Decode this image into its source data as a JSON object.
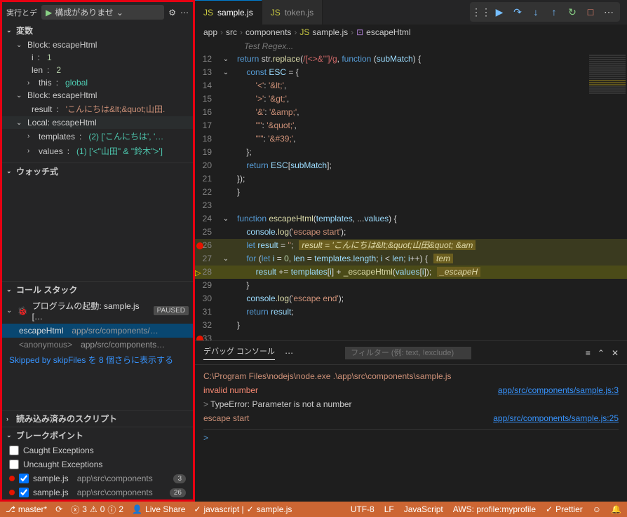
{
  "sidebar": {
    "top_label": "実行とデ",
    "config_label": "構成がありませ",
    "sections": {
      "variables": "変数",
      "watch": "ウォッチ式",
      "callstack": "コール スタック",
      "loaded": "読み込み済みのスクリプト",
      "breakpoints": "ブレークポイント"
    },
    "vars": {
      "block1": "Block: escapeHtml",
      "i_key": "i",
      "i_val": "1",
      "len_key": "len",
      "len_val": "2",
      "this_key": "this",
      "this_val": "global",
      "block2": "Block: escapeHtml",
      "result_key": "result",
      "result_val": "'こんにちは&lt;&quot;山田.",
      "local": "Local: escapeHtml",
      "templates_key": "templates",
      "templates_val": "(2) ['こんにちは', '…",
      "values_key": "values",
      "values_val": "(1) ['<\"山田\" & \"鈴木\">']"
    },
    "callstack": {
      "launch": "プログラムの起動: sample.js […",
      "paused": "PAUSED",
      "row1_fn": "escapeHtml",
      "row1_path": "app/src/components/…",
      "row2_fn": "<anonymous>",
      "row2_path": "app/src/components…",
      "skipped": "Skipped by skipFiles を 8 個さらに表示する"
    },
    "breakpoints": {
      "caught": "Caught Exceptions",
      "uncaught": "Uncaught Exceptions",
      "bp1_file": "sample.js",
      "bp1_path": "app\\src\\components",
      "bp1_count": "3",
      "bp2_file": "sample.js",
      "bp2_path": "app\\src\\components",
      "bp2_count": "26"
    }
  },
  "tabs": {
    "t1": "sample.js",
    "t2": "token.js"
  },
  "breadcrumb": {
    "app": "app",
    "src": "src",
    "components": "components",
    "file": "sample.js",
    "fn": "escapeHtml"
  },
  "test_regex": "Test Regex...",
  "code": {
    "l12": [
      "return",
      " str.",
      "replace",
      "(",
      "/[<>&\"']/g",
      ", ",
      "function",
      " (",
      "subMatch",
      ") {"
    ],
    "l13": [
      "    ",
      "const",
      " ",
      "ESC",
      " = {"
    ],
    "l14": [
      "        ",
      "'<'",
      ": ",
      "'&lt;'",
      ","
    ],
    "l15": [
      "        ",
      "'>'",
      ": ",
      "'&gt;'",
      ","
    ],
    "l16": [
      "        ",
      "'&'",
      ": ",
      "'&amp;'",
      ","
    ],
    "l17": [
      "        ",
      "'\"'",
      ": ",
      "'&quot;'",
      ","
    ],
    "l18": [
      "        ",
      "\"'\"",
      ": ",
      "'&#39;'",
      ","
    ],
    "l19": [
      "    };"
    ],
    "l20": [
      "    ",
      "return",
      " ",
      "ESC",
      "[",
      "subMatch",
      "];"
    ],
    "l21": [
      "});"
    ],
    "l22": [
      "}"
    ],
    "l23": [
      ""
    ],
    "l24": [
      "function",
      " ",
      "escapeHtml",
      "(",
      "templates",
      ", ...",
      "values",
      ") {"
    ],
    "l25": [
      "    ",
      "console",
      ".",
      "log",
      "(",
      "'escape start'",
      ");"
    ],
    "l26": [
      "    ",
      "let",
      " ",
      "result",
      " = ",
      "''",
      ";"
    ],
    "l26_inline": "result = 'こんにちは&lt;&quot;山田&quot; &am",
    "l27": [
      "    ",
      "for",
      " (",
      "let",
      " ",
      "i",
      " = ",
      "0",
      ", ",
      "len",
      " = ",
      "templates",
      ".",
      "length",
      "; ",
      "i",
      " < ",
      "len",
      "; ",
      "i",
      "++) {"
    ],
    "l27_inline": "tem",
    "l28": [
      "        ",
      "result",
      " += ",
      "templates",
      "[",
      "i",
      "] + ",
      "_escapeHtml",
      "(",
      "values",
      "[",
      "i",
      "]);"
    ],
    "l28_inline": "_escapeH",
    "l29": [
      "    }"
    ],
    "l30": [
      "    ",
      "console",
      ".",
      "log",
      "(",
      "'escape end'",
      ");"
    ],
    "l31": [
      "    ",
      "return",
      " ",
      "result",
      ";"
    ],
    "l32": [
      "}"
    ],
    "l33": [
      ""
    ]
  },
  "console": {
    "tab": "デバッグ コンソール",
    "filter_ph": "フィルター (例: text, !exclude)",
    "line1": "C:\\Program Files\\nodejs\\node.exe .\\app\\src\\components\\sample.js",
    "line2": "invalid number",
    "line2_link": "app/src/components/sample.js:3",
    "line3_pre": "> ",
    "line3": "TypeError: Parameter is not a number",
    "line4": "escape start",
    "line4_link": "app/src/components/sample.js:25",
    "prompt": ">"
  },
  "statusbar": {
    "branch": "master*",
    "sync": "",
    "errors_num": "3",
    "warnings_num": "0",
    "info_num": "2",
    "liveshare": "Live Share",
    "lang_check": "javascript |",
    "file": "sample.js",
    "encoding": "UTF-8",
    "eol": "LF",
    "lang": "JavaScript",
    "aws": "AWS: profile:myprofile",
    "prettier": "Prettier"
  }
}
